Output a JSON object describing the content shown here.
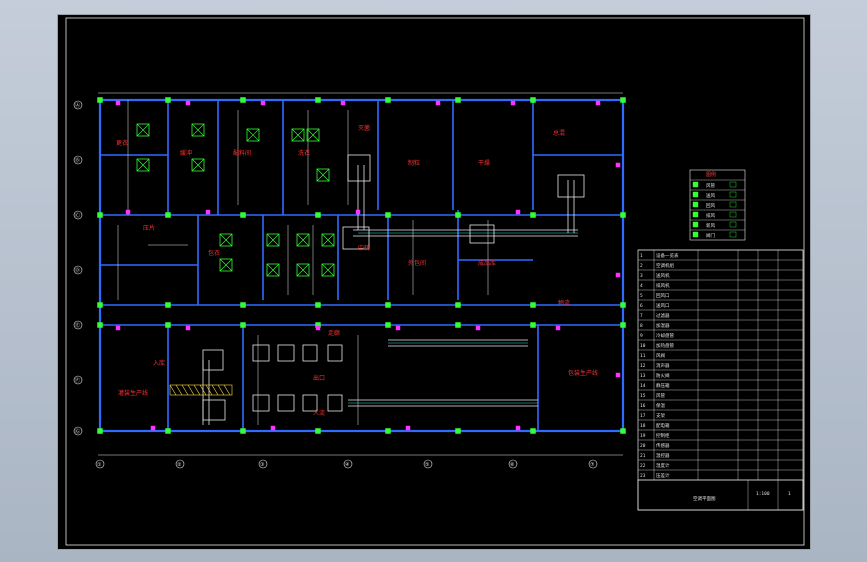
{
  "drawing": {
    "rooms": [
      {
        "id": "r1",
        "text": "更衣"
      },
      {
        "id": "r2",
        "text": "缓冲"
      },
      {
        "id": "r3",
        "text": "配料间"
      },
      {
        "id": "r4",
        "text": "洗衣"
      },
      {
        "id": "r5",
        "text": "灭菌"
      },
      {
        "id": "r6",
        "text": "制粒"
      },
      {
        "id": "r7",
        "text": "干燥"
      },
      {
        "id": "r8",
        "text": "总混"
      },
      {
        "id": "r9",
        "text": "压片"
      },
      {
        "id": "r10",
        "text": "包衣"
      },
      {
        "id": "r11",
        "text": "中转"
      },
      {
        "id": "r12",
        "text": "外包间"
      },
      {
        "id": "r13",
        "text": "成品库"
      },
      {
        "id": "r14",
        "text": "入库"
      },
      {
        "id": "r15",
        "text": "灌装生产线"
      },
      {
        "id": "r16",
        "text": "包装生产线"
      },
      {
        "id": "r17",
        "text": "出口"
      },
      {
        "id": "r18",
        "text": "人流"
      },
      {
        "id": "r19",
        "text": "物流"
      },
      {
        "id": "r20",
        "text": "走廊"
      }
    ],
    "axis_columns": [
      "①",
      "②",
      "③",
      "④",
      "⑤",
      "⑥",
      "⑦"
    ],
    "axis_rows": [
      "Ⓐ",
      "Ⓑ",
      "Ⓒ",
      "Ⓓ",
      "Ⓔ",
      "Ⓕ",
      "Ⓖ"
    ],
    "legend": {
      "title": "图例",
      "rows": [
        "风管",
        "送风",
        "回风",
        "排风",
        "新风",
        "阀门"
      ]
    },
    "title_block": {
      "rows": [
        "设备一览表",
        "空调机组",
        "送风机",
        "排风机",
        "回风口",
        "送风口",
        "过滤器",
        "加湿器",
        "冷却盘管",
        "加热盘管",
        "风阀",
        "消声器",
        "防火阀",
        "静压箱",
        "风管",
        "保温",
        "支架",
        "配电箱",
        "控制柜",
        "传感器",
        "温控器",
        "湿度计",
        "压差计"
      ],
      "drawing_name": "空调平面图",
      "scale": "1:100",
      "sheet": "1"
    }
  }
}
